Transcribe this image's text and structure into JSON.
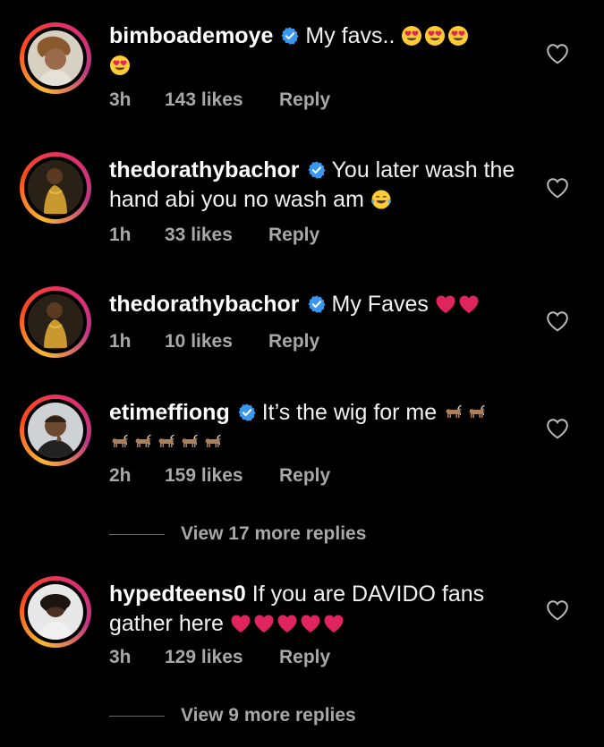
{
  "comments": [
    {
      "username": "bimboademoye",
      "verified": true,
      "text": "My favs..",
      "emoji_after": [
        "heart-eyes",
        "heart-eyes",
        "heart-eyes",
        "heart-eyes"
      ],
      "time": "3h",
      "likes": "143 likes",
      "reply": "Reply"
    },
    {
      "username": "thedorathybachor",
      "verified": true,
      "text": "You later wash the hand abi you no wash am",
      "emoji_after": [
        "tears-of-joy"
      ],
      "time": "1h",
      "likes": "33 likes",
      "reply": "Reply"
    },
    {
      "username": "thedorathybachor",
      "verified": true,
      "text": "My Faves",
      "emoji_after": [
        "red-heart",
        "red-heart"
      ],
      "time": "1h",
      "likes": "10 likes",
      "reply": "Reply"
    },
    {
      "username": "etimeffiong",
      "verified": true,
      "text": "It’s the wig for me",
      "emoji_after": [
        "goat",
        "goat",
        "goat",
        "goat",
        "goat",
        "goat",
        "goat"
      ],
      "time": "2h",
      "likes": "159 likes",
      "reply": "Reply"
    },
    {
      "username": "hypedteens0",
      "verified": false,
      "text": "If you are DAVIDO fans gather here",
      "emoji_after": [
        "red-heart",
        "red-heart",
        "red-heart",
        "red-heart",
        "red-heart"
      ],
      "time": "3h",
      "likes": "129 likes",
      "reply": "Reply"
    }
  ],
  "view_replies": [
    {
      "label": "View 17 more replies"
    },
    {
      "label": "View 9 more replies"
    }
  ],
  "colors": {
    "background": "#000000",
    "text": "#f2f2f2",
    "meta": "#a8a8a8",
    "verified": "#3897f0",
    "heart": "#e0245e"
  }
}
